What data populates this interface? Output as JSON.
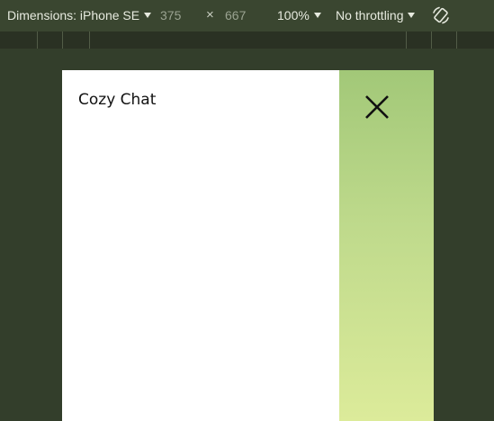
{
  "toolbar": {
    "dimensions_label": "Dimensions: iPhone SE",
    "width_value": "375",
    "times_symbol": "×",
    "height_value": "667",
    "zoom_label": "100%",
    "throttling_label": "No throttling",
    "rotate_icon": "rotate-icon"
  },
  "app": {
    "title": "Cozy Chat",
    "close_icon": "close-icon",
    "colors": {
      "panel_top": "#a2c878",
      "panel_bottom": "#dceb9a"
    }
  }
}
